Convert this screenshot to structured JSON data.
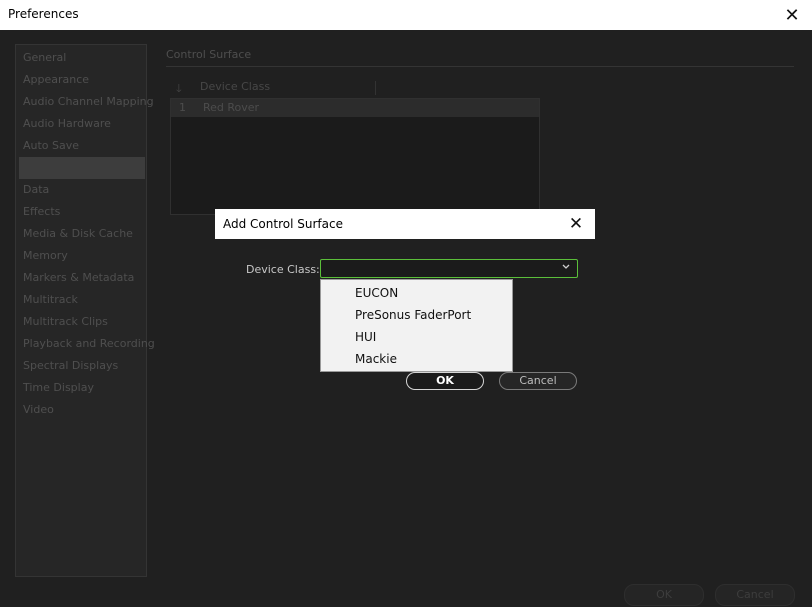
{
  "window": {
    "title": "Preferences"
  },
  "sidebar": {
    "items": [
      {
        "label": "General"
      },
      {
        "label": "Appearance"
      },
      {
        "label": "Audio Channel Mapping"
      },
      {
        "label": "Audio Hardware"
      },
      {
        "label": "Auto Save"
      },
      {
        "label": ""
      },
      {
        "label": "Data"
      },
      {
        "label": "Effects"
      },
      {
        "label": "Media & Disk Cache"
      },
      {
        "label": "Memory"
      },
      {
        "label": "Markers & Metadata"
      },
      {
        "label": "Multitrack"
      },
      {
        "label": "Multitrack Clips"
      },
      {
        "label": "Playback and Recording"
      },
      {
        "label": "Spectral Displays"
      },
      {
        "label": "Time Display"
      },
      {
        "label": "Video"
      }
    ]
  },
  "panel": {
    "title": "Control Surface",
    "table": {
      "sort_icon": "down-arrow-icon",
      "column": "Device Class",
      "rows": [
        {
          "num": "1",
          "name": "Red Rover"
        }
      ]
    }
  },
  "footer": {
    "ok": "OK",
    "cancel": "Cancel"
  },
  "dialog": {
    "title": "Add Control Surface",
    "device_label": "Device Class:",
    "device_value": "",
    "options": [
      "EUCON",
      "PreSonus FaderPort",
      "HUI",
      "Mackie"
    ],
    "ok": "OK",
    "cancel": "Cancel",
    "accent_color": "#5bbf3a"
  }
}
